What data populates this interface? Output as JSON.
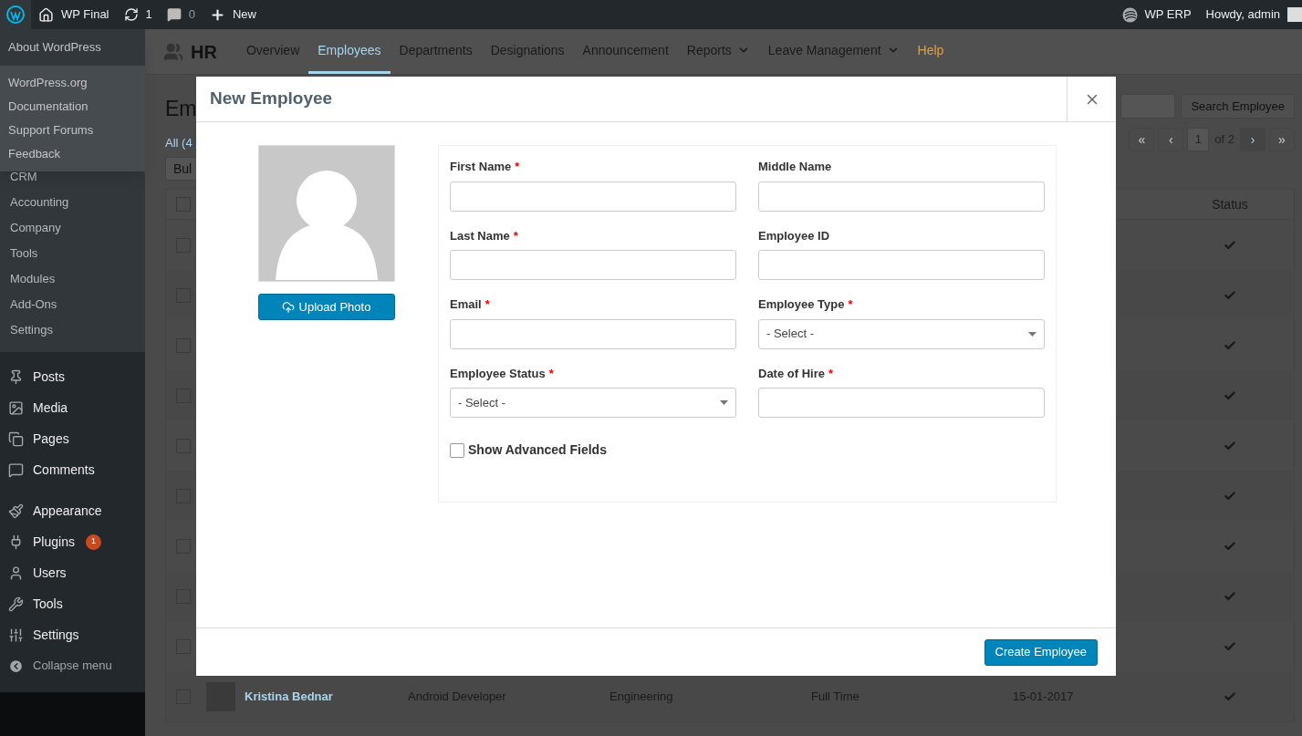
{
  "admin_bar": {
    "site": "WP Final",
    "updates": "1",
    "comments": "0",
    "new": "New",
    "erp": "WP ERP",
    "greeting": "Howdy, admin"
  },
  "wp_menu": {
    "about": "About WordPress",
    "links": [
      "WordPress.org",
      "Documentation",
      "Support Forums",
      "Feedback"
    ]
  },
  "sidebar": {
    "submenu": [
      "CRM",
      "Accounting",
      "Company",
      "Tools",
      "Modules",
      "Add-Ons",
      "Settings"
    ],
    "groups": [
      [
        {
          "label": "Posts"
        },
        {
          "label": "Media"
        },
        {
          "label": "Pages"
        },
        {
          "label": "Comments"
        }
      ],
      [
        {
          "label": "Appearance"
        },
        {
          "label": "Plugins",
          "badge": "1"
        },
        {
          "label": "Users"
        },
        {
          "label": "Tools"
        },
        {
          "label": "Settings"
        }
      ]
    ],
    "collapse": "Collapse menu"
  },
  "hr_nav": {
    "title": "HR",
    "tabs": [
      {
        "label": "Overview",
        "selected": false,
        "kind": "tab"
      },
      {
        "label": "Employees",
        "selected": true,
        "kind": "tab"
      },
      {
        "label": "Departments",
        "selected": false,
        "kind": "tab"
      },
      {
        "label": "Designations",
        "selected": false,
        "kind": "tab"
      },
      {
        "label": "Announcement",
        "selected": false,
        "kind": "tab"
      },
      {
        "label": "Reports",
        "selected": false,
        "kind": "menu"
      },
      {
        "label": "Leave Management",
        "selected": false,
        "kind": "menu"
      },
      {
        "label": "Help",
        "selected": false,
        "kind": "help"
      }
    ]
  },
  "page": {
    "title": "Em",
    "filter": "All (4",
    "bulk": "Bul",
    "search_button": "Search Employee",
    "pagination": {
      "first": "«",
      "prev": "‹",
      "page": "1",
      "of": "of 2",
      "next": "›",
      "last": "»"
    },
    "table": {
      "select_all_checked": false,
      "status_header": "Status",
      "rows": [
        {
          "checked": false,
          "active": true
        },
        {
          "checked": false,
          "active": true
        },
        {
          "checked": false,
          "active": true
        },
        {
          "checked": false,
          "active": true
        },
        {
          "checked": false,
          "active": true
        },
        {
          "checked": false,
          "active": true
        },
        {
          "checked": false,
          "active": true
        },
        {
          "checked": false,
          "active": true
        },
        {
          "checked": false,
          "active": true
        },
        {
          "checked": false,
          "active": true,
          "name": "Kristina Bednar",
          "designation": "Android Developer",
          "department": "Engineering",
          "type": "Full Time",
          "date": "15-01-2017"
        }
      ]
    }
  },
  "modal": {
    "title": "New Employee",
    "upload": "Upload Photo",
    "required_mark": "*",
    "fields": [
      {
        "label": "First Name",
        "required": true,
        "kind": "text"
      },
      {
        "label": "Middle Name",
        "required": false,
        "kind": "text"
      },
      {
        "label": "Last Name",
        "required": true,
        "kind": "text"
      },
      {
        "label": "Employee ID",
        "required": false,
        "kind": "text"
      },
      {
        "label": "Email",
        "required": true,
        "kind": "text"
      },
      {
        "label": "Employee Type",
        "required": true,
        "kind": "select",
        "value": "- Select -"
      },
      {
        "label": "Employee Status",
        "required": true,
        "kind": "select",
        "value": "- Select -"
      },
      {
        "label": "Date of Hire",
        "required": true,
        "kind": "text"
      }
    ],
    "advanced": {
      "label": "Show Advanced Fields",
      "checked": false
    },
    "submit": "Create Employee"
  }
}
